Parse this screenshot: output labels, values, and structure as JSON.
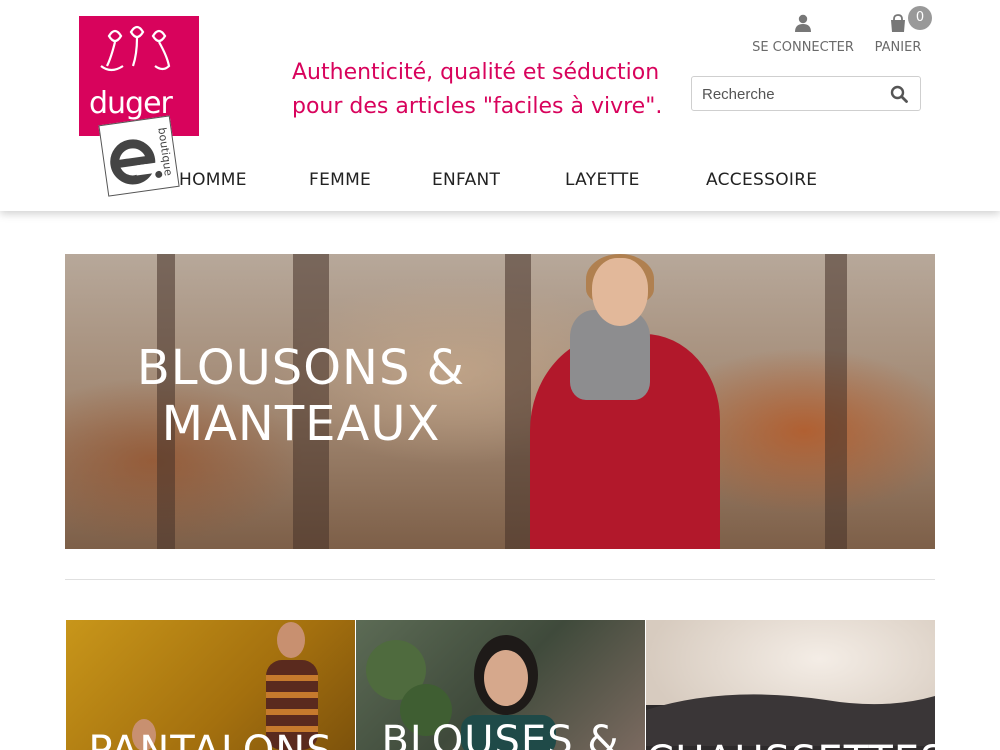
{
  "brand": {
    "name": "duger",
    "sub": "e.boutique",
    "colors": {
      "primary": "#d8035c",
      "header_text": "#6a6a6a",
      "badge": "#999999"
    }
  },
  "tagline": {
    "line1": "Authenticité, qualité et séduction",
    "line2": "pour des articles \"faciles à vivre\"."
  },
  "header": {
    "account_label": "SE CONNECTER",
    "account_icon": "user-icon",
    "cart_label": "PANIER",
    "cart_icon": "shopping-bag-icon",
    "cart_count": "0"
  },
  "search": {
    "placeholder": "Recherche",
    "value": "",
    "icon": "search-icon"
  },
  "nav": {
    "items": [
      {
        "label": "HOMME"
      },
      {
        "label": "FEMME"
      },
      {
        "label": "ENFANT"
      },
      {
        "label": "LAYETTE"
      },
      {
        "label": "ACCESSOIRE"
      }
    ]
  },
  "hero": {
    "line1": "BLOUSONS &",
    "line2": "MANTEAUX"
  },
  "categories": [
    {
      "label": "PANTALONS"
    },
    {
      "label": "BLOUSES &"
    },
    {
      "label": "CHAUSSETTES"
    }
  ]
}
